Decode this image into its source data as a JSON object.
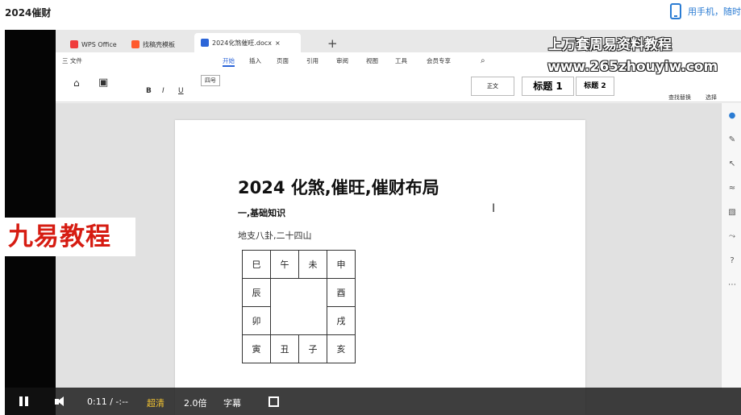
{
  "header": {
    "title": "2024催财",
    "mobile_link": "用手机，随时"
  },
  "wps": {
    "tabs": [
      "WPS Office",
      "找稿壳模板",
      "2024化煞催旺.docx"
    ],
    "menu": [
      "三 文件",
      "开始",
      "插入",
      "页面",
      "引用",
      "审阅",
      "视图",
      "工具",
      "会员专享"
    ],
    "ribbon": {
      "font_size": "四号",
      "style_normal": "正文",
      "style_h1": "标题 1",
      "style_h2": "标题 2",
      "find_replace": "查找替换",
      "select": "选择"
    }
  },
  "watermark": {
    "line1": "上万套周易资料教程",
    "line2": "www.265zhouyiw.com"
  },
  "overlay": {
    "brand": "九易教程"
  },
  "document": {
    "title": "2024 化煞,催旺,催财布局",
    "section": "一,基础知识",
    "subtitle": "地支八卦,二十四山",
    "table": [
      [
        "巳",
        "午",
        "未",
        "申"
      ],
      [
        "辰",
        "",
        "",
        "酉"
      ],
      [
        "卯",
        "",
        "",
        "戌"
      ],
      [
        "寅",
        "丑",
        "子",
        "亥"
      ]
    ]
  },
  "player": {
    "time": "0:11 / -:--",
    "quality": "超清",
    "speed": "2.0倍",
    "subtitles": "字幕"
  },
  "icons": [
    "phone-icon",
    "pause-icon",
    "volume-icon",
    "fullscreen-icon"
  ]
}
